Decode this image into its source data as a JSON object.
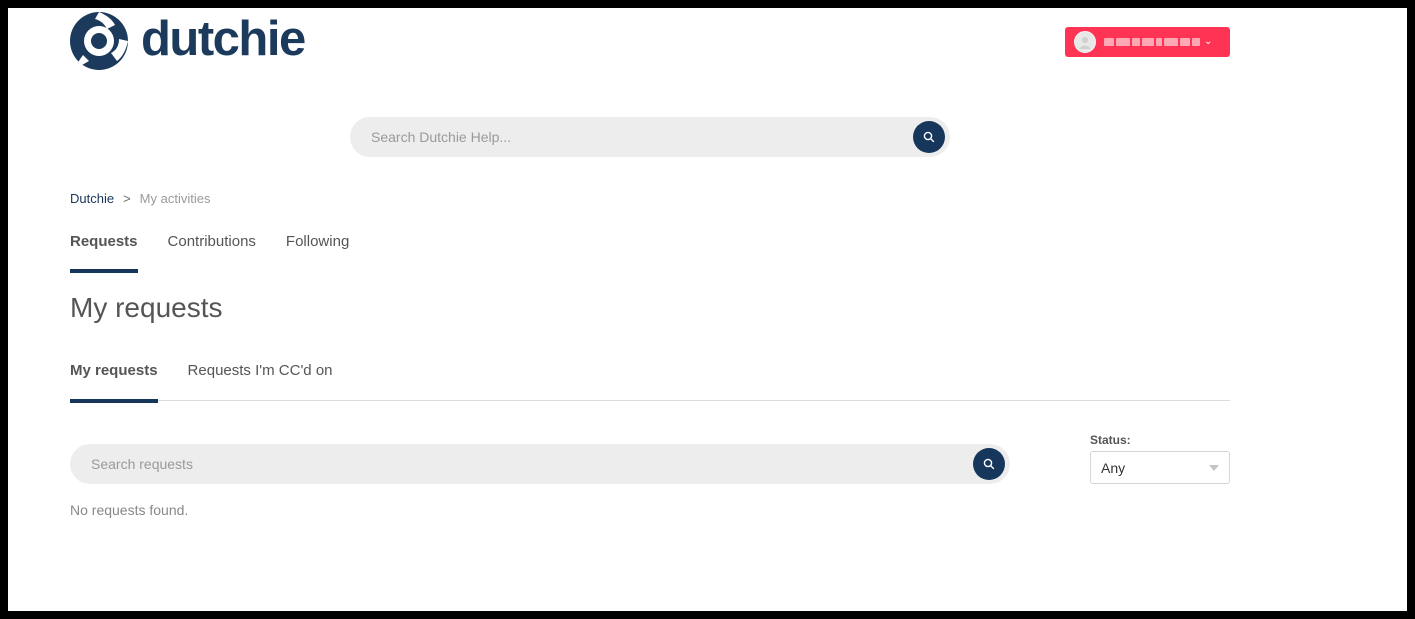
{
  "brand": {
    "logo_text": "dutchie",
    "logo_icon": "dutchie-logo-icon",
    "brand_color": "#1b3a5c",
    "accent_color": "#ff3454"
  },
  "user_menu": {
    "avatar_icon": "user-avatar-icon",
    "chevron_icon": "chevron-down-icon",
    "chevron_glyph": "⌄"
  },
  "top_search": {
    "placeholder": "Search Dutchie Help...",
    "icon": "search-icon"
  },
  "breadcrumb": {
    "root": "Dutchie",
    "separator": ">",
    "current": "My activities"
  },
  "activity_tabs": [
    {
      "label": "Requests",
      "active": true
    },
    {
      "label": "Contributions",
      "active": false
    },
    {
      "label": "Following",
      "active": false
    }
  ],
  "page_title": "My requests",
  "request_tabs": [
    {
      "label": "My requests",
      "active": true
    },
    {
      "label": "Requests I'm CC'd on",
      "active": false
    }
  ],
  "request_search": {
    "placeholder": "Search requests",
    "icon": "search-icon"
  },
  "status_filter": {
    "label": "Status:",
    "selected": "Any"
  },
  "empty_message": "No requests found."
}
